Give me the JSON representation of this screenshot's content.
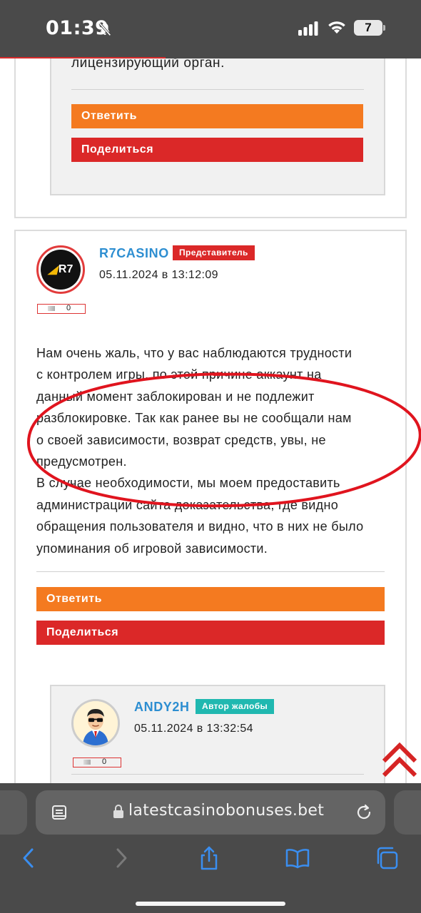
{
  "status_bar": {
    "time": "01:39",
    "battery": "7",
    "icons": [
      "bell-slash-icon",
      "signal-icon",
      "wifi-icon",
      "battery-icon"
    ]
  },
  "comment_prev": {
    "text_tail": "лицензирующий орган.",
    "reply_label": "Ответить",
    "share_label": "Поделиться"
  },
  "comment_main": {
    "username": "R7CASINO",
    "badge": "Представитель",
    "date": "05.11.2024 в 13:12:09",
    "avatar_text": "R7",
    "rating": "0",
    "body_lines": [
      "Нам очень жаль, что у вас наблюдаются трудности",
      "с контролем игры, по этой причине аккаунт на",
      "данный момент заблокирован и не подлежит",
      "разблокировке. Так как ранее вы не сообщали нам",
      "о своей зависимости, возврат средств, увы, не",
      "предусмотрен.",
      "В случае необходимости, мы моем предоставить",
      "администрации сайта доказательства, где видно",
      "обращения пользователя и видно, что в них не было",
      "упоминания об игровой зависимости."
    ],
    "reply_label": "Ответить",
    "share_label": "Поделиться"
  },
  "comment_reply": {
    "username": "ANDY2H",
    "badge": "Автор жалобы",
    "date": "05.11.2024 в 13:32:54",
    "rating": "0"
  },
  "browser": {
    "url": "latestcasinobonuses.bet",
    "icons": [
      "reader-icon",
      "lock-icon",
      "reload-icon",
      "back-icon",
      "forward-icon",
      "share-icon",
      "bookmarks-icon",
      "tabs-icon"
    ]
  },
  "colors": {
    "accent_orange": "#f47a20",
    "accent_red": "#db2828",
    "username_blue": "#2d8ed1",
    "badge_teal": "#20b8b0",
    "annotation_red": "#e0141e",
    "ios_blue": "#3a8ef0"
  }
}
